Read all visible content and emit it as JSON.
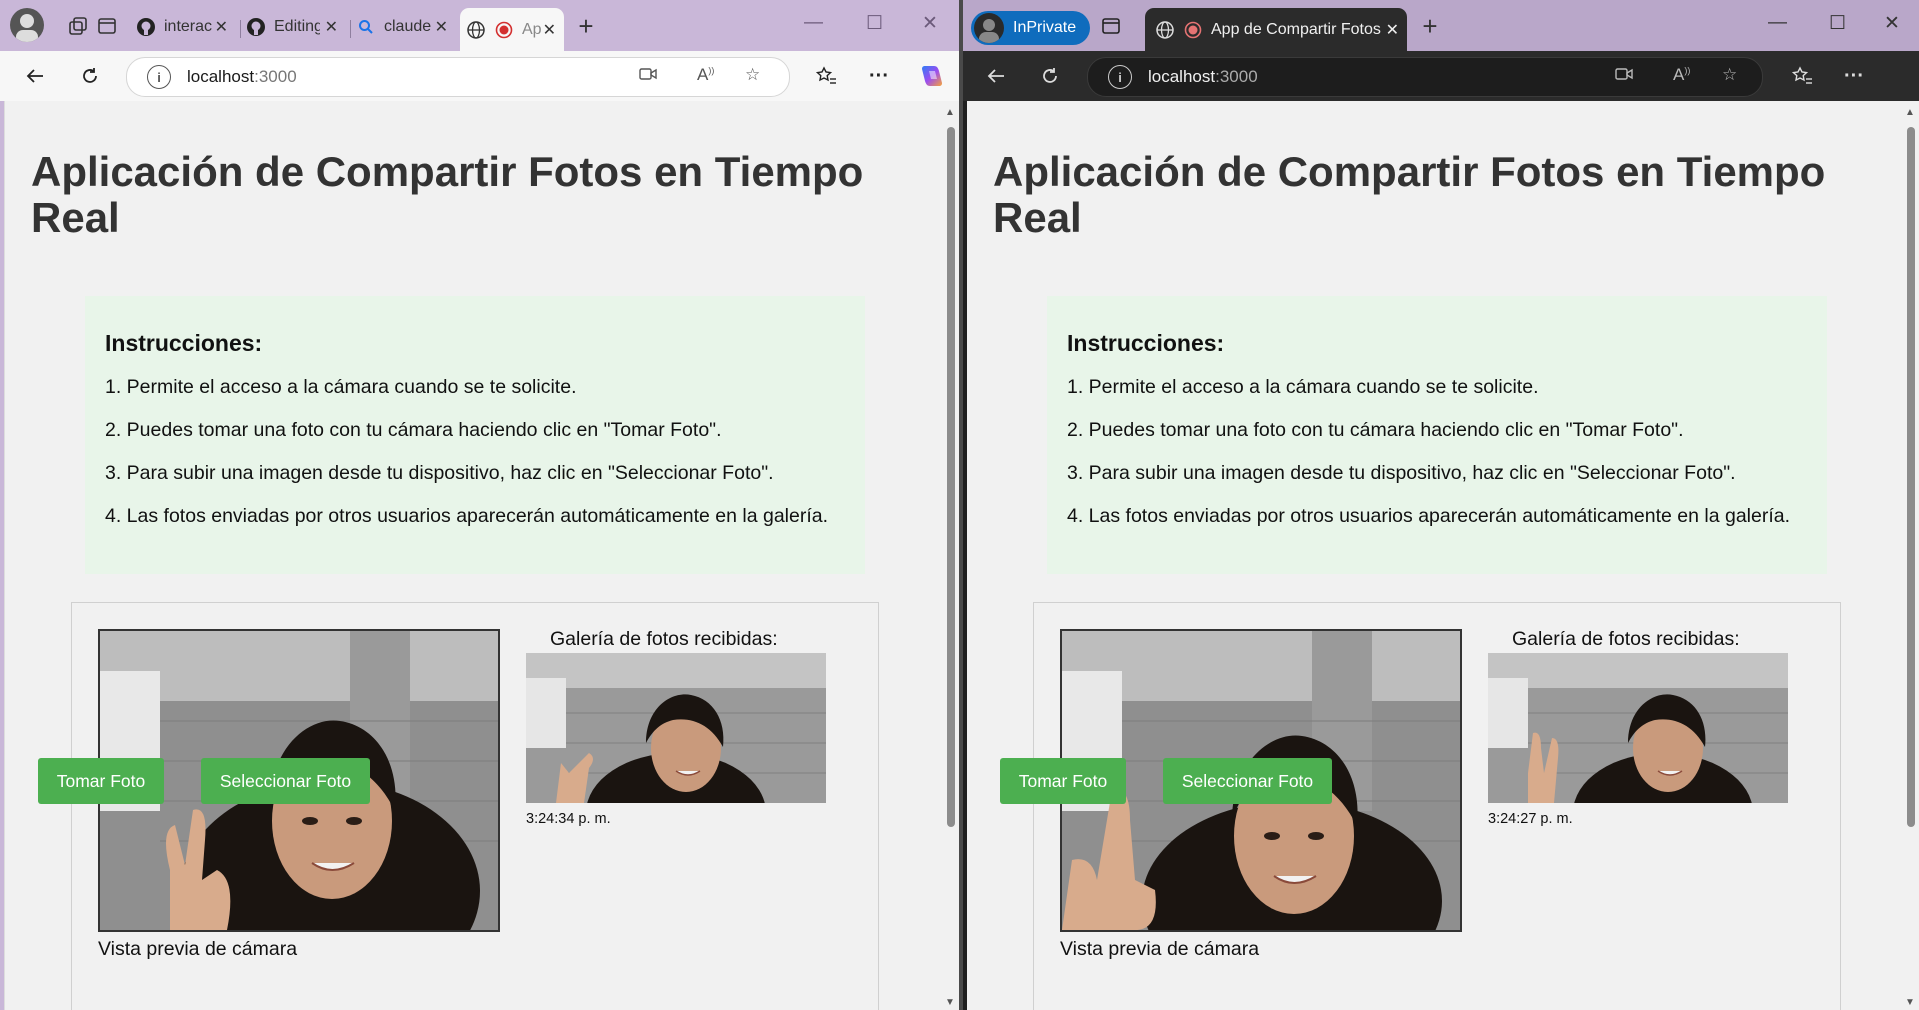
{
  "left_window": {
    "tabs": [
      {
        "label": "interacti",
        "icon": "github-icon"
      },
      {
        "label": "Editing",
        "icon": "github-icon"
      },
      {
        "label": "claude -",
        "icon": "search-icon"
      },
      {
        "label": "Ap",
        "icon": "globe-icon"
      }
    ],
    "url": {
      "host": "localhost",
      "port": ":3000"
    }
  },
  "right_window": {
    "inprivate_label": "InPrivate",
    "tabs": [
      {
        "label": "App de Compartir Fotos",
        "icon": "globe-icon"
      }
    ],
    "url": {
      "host": "localhost",
      "port": ":3000"
    }
  },
  "page": {
    "title": "Aplicación de Compartir Fotos en Tiempo Real",
    "instructions_heading": "Instrucciones:",
    "instructions": [
      "1. Permite el acceso a la cámara cuando se te solicite.",
      "2. Puedes tomar una foto con tu cámara haciendo clic en \"Tomar Foto\".",
      "3. Para subir una imagen desde tu dispositivo, haz clic en \"Seleccionar Foto\".",
      "4. Las fotos enviadas por otros usuarios aparecerán automáticamente en la galería."
    ],
    "take_photo_label": "Tomar Foto",
    "select_photo_label": "Seleccionar Foto",
    "camera_label": "Vista previa de cámara",
    "gallery_title": "Galería de fotos recibidas:"
  },
  "left_gallery_timestamp": "3:24:34 p. m.",
  "right_gallery_timestamp": "3:24:27 p. m.",
  "colors": {
    "button": "#4caf50",
    "instructions_bg": "#e8f5e9",
    "inprivate": "#0f6cbd"
  }
}
